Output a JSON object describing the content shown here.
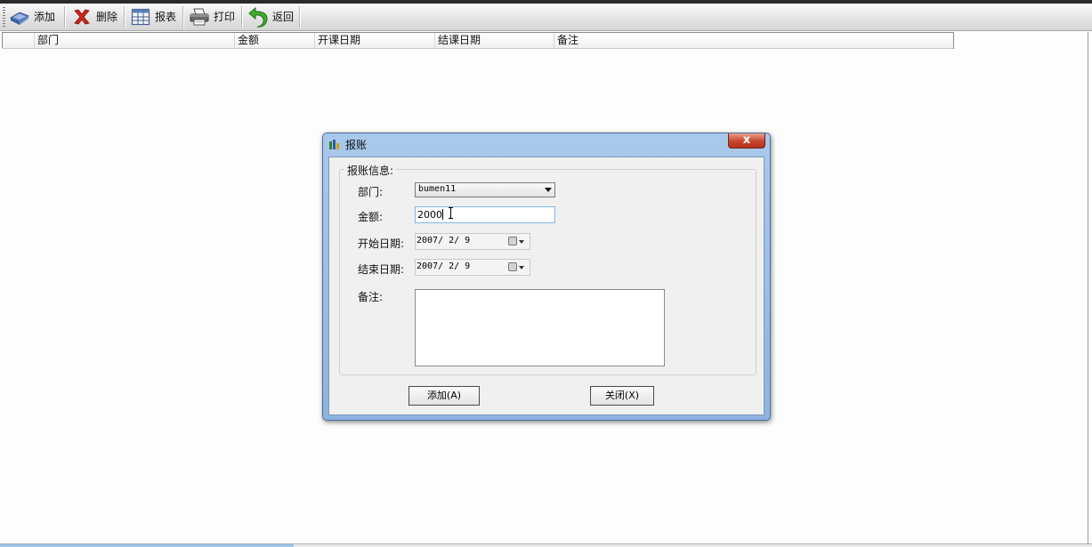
{
  "toolbar": {
    "buttons": [
      {
        "label": "添加",
        "icon": "add-icon"
      },
      {
        "label": "删除",
        "icon": "delete-icon"
      },
      {
        "label": "报表",
        "icon": "report-icon"
      },
      {
        "label": "打印",
        "icon": "print-icon"
      },
      {
        "label": "返回",
        "icon": "back-icon"
      }
    ]
  },
  "grid": {
    "columns": [
      "部门",
      "金额",
      "开课日期",
      "结课日期",
      "备注"
    ]
  },
  "dialog": {
    "title": "报账",
    "close_label": "x",
    "group_label": "报账信息:",
    "fields": {
      "department": {
        "label": "部门:",
        "value": "bumen11"
      },
      "amount": {
        "label": "金额:",
        "value": "2000"
      },
      "start_date": {
        "label": "开始日期:",
        "value": "2007/ 2/ 9"
      },
      "end_date": {
        "label": "结束日期:",
        "value": "2007/ 2/ 9"
      },
      "notes": {
        "label": "备注:",
        "value": ""
      }
    },
    "buttons": {
      "add_label": "添加(A)",
      "close_label": "关闭(X)"
    }
  },
  "colors": {
    "dialog_frame": "#a9c9ec",
    "close_button": "#c8452d",
    "toolbar_bg": "#e2e2e2"
  }
}
